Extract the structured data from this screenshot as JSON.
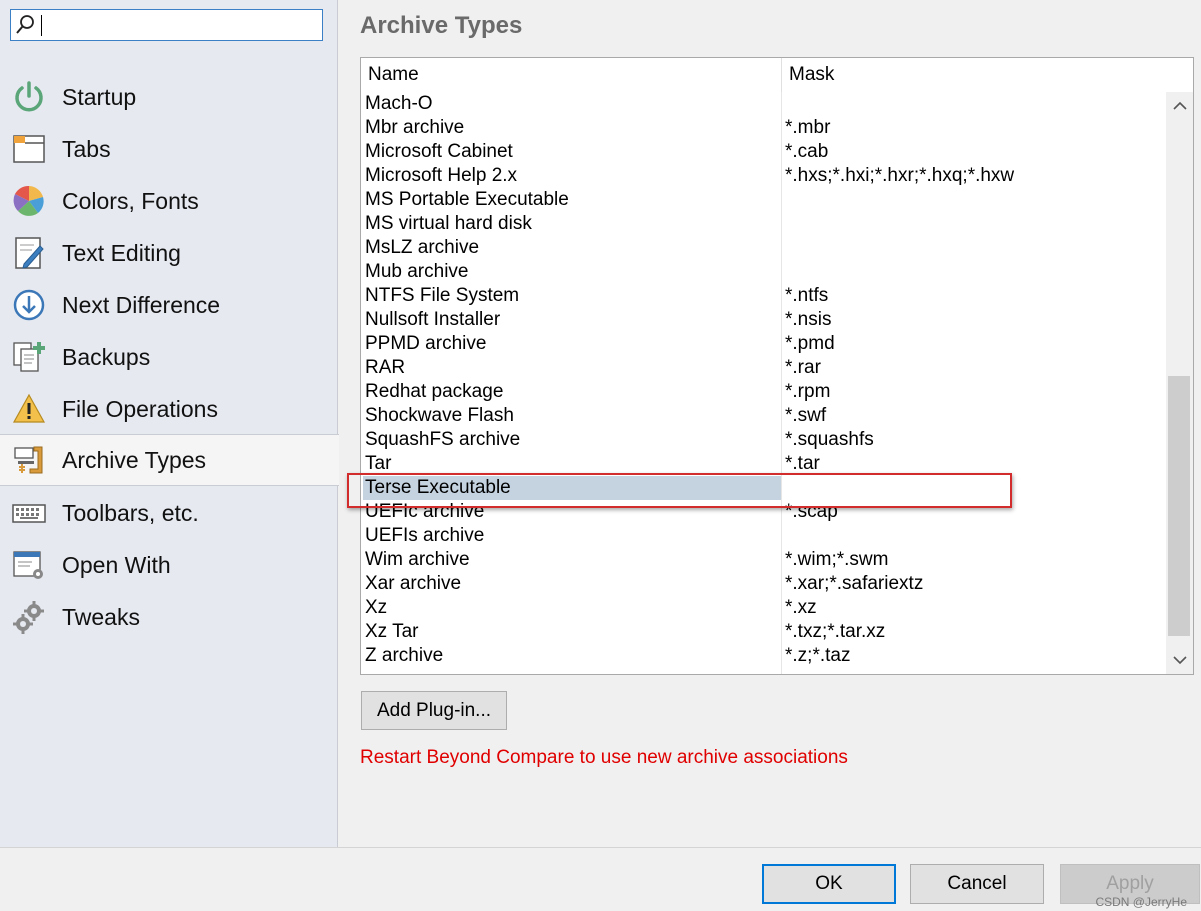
{
  "sidebar": {
    "search": {
      "value": ""
    },
    "items": [
      {
        "label": "Startup",
        "icon": "power-icon"
      },
      {
        "label": "Tabs",
        "icon": "tabs-icon"
      },
      {
        "label": "Colors, Fonts",
        "icon": "palette-icon"
      },
      {
        "label": "Text Editing",
        "icon": "edit-document-icon"
      },
      {
        "label": "Next Difference",
        "icon": "arrow-down-circle-icon"
      },
      {
        "label": "Backups",
        "icon": "backup-copy-icon"
      },
      {
        "label": "File Operations",
        "icon": "warning-icon"
      },
      {
        "label": "Archive Types",
        "icon": "archive-clamp-icon",
        "selected": true
      },
      {
        "label": "Toolbars, etc.",
        "icon": "keyboard-icon"
      },
      {
        "label": "Open With",
        "icon": "open-with-icon"
      },
      {
        "label": "Tweaks",
        "icon": "gears-icon"
      }
    ]
  },
  "main": {
    "title": "Archive Types",
    "columns": {
      "name": "Name",
      "mask": "Mask"
    },
    "rows": [
      {
        "name": "Mach-O",
        "mask": ""
      },
      {
        "name": "Mbr archive",
        "mask": "*.mbr"
      },
      {
        "name": "Microsoft Cabinet",
        "mask": "*.cab"
      },
      {
        "name": "Microsoft Help 2.x",
        "mask": "*.hxs;*.hxi;*.hxr;*.hxq;*.hxw"
      },
      {
        "name": "MS Portable Executable",
        "mask": ""
      },
      {
        "name": "MS virtual hard disk",
        "mask": ""
      },
      {
        "name": "MsLZ archive",
        "mask": ""
      },
      {
        "name": "Mub archive",
        "mask": ""
      },
      {
        "name": "NTFS File System",
        "mask": "*.ntfs"
      },
      {
        "name": "Nullsoft Installer",
        "mask": "*.nsis"
      },
      {
        "name": "PPMD archive",
        "mask": "*.pmd"
      },
      {
        "name": "RAR",
        "mask": "*.rar"
      },
      {
        "name": "Redhat package",
        "mask": "*.rpm"
      },
      {
        "name": "Shockwave Flash",
        "mask": "*.swf"
      },
      {
        "name": "SquashFS archive",
        "mask": "*.squashfs"
      },
      {
        "name": "Tar",
        "mask": "*.tar"
      },
      {
        "name": "Terse Executable",
        "mask": "",
        "selected": true
      },
      {
        "name": "UEFIc archive",
        "mask": "*.scap"
      },
      {
        "name": "UEFIs archive",
        "mask": ""
      },
      {
        "name": "Wim archive",
        "mask": "*.wim;*.swm"
      },
      {
        "name": "Xar archive",
        "mask": "*.xar;*.safariextz"
      },
      {
        "name": "Xz",
        "mask": "*.xz"
      },
      {
        "name": "Xz Tar",
        "mask": "*.txz;*.tar.xz"
      },
      {
        "name": "Z archive",
        "mask": "*.z;*.taz"
      }
    ],
    "add_plugin_label": "Add Plug-in...",
    "restart_message": "Restart Beyond Compare to use new archive associations"
  },
  "footer": {
    "ok_label": "OK",
    "cancel_label": "Cancel",
    "apply_label": "Apply",
    "watermark": "CSDN @JerryHe"
  },
  "colors": {
    "selection": "#c5d3e1",
    "warning_text": "#e00000",
    "highlight_box": "#d22c2c",
    "focus_border": "#0078d7"
  }
}
